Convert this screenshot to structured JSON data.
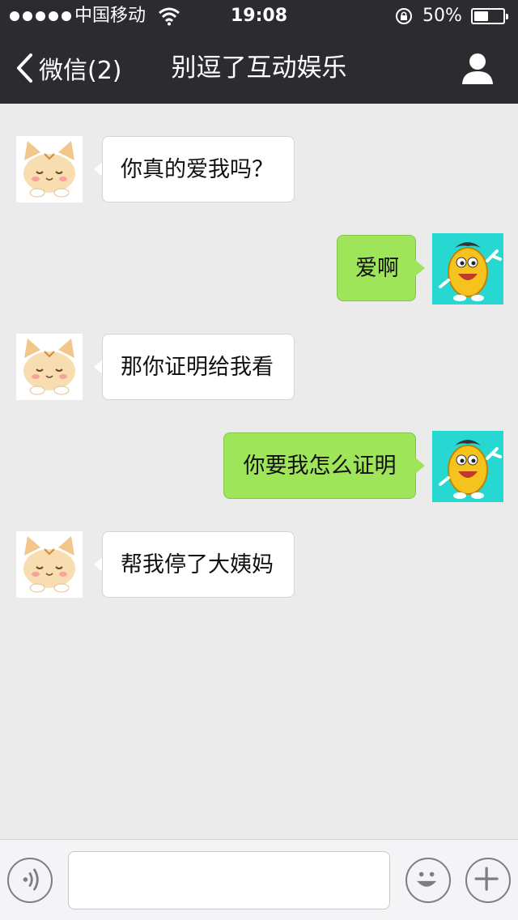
{
  "status_bar": {
    "carrier": "中国移动",
    "time": "19:08",
    "battery_percent": "50%",
    "battery_level": 0.5,
    "signal_bars": 5
  },
  "nav": {
    "back_label": "微信(2)",
    "title": "别逗了互动娱乐"
  },
  "messages": [
    {
      "sender": "other",
      "text": "你真的爱我吗？",
      "avatar": "cat-avatar"
    },
    {
      "sender": "me",
      "text": "爱啊",
      "avatar": "potato-avatar"
    },
    {
      "sender": "other",
      "text": "那你证明给我看",
      "avatar": "cat-avatar"
    },
    {
      "sender": "me",
      "text": "你要我怎么证明",
      "avatar": "potato-avatar"
    },
    {
      "sender": "other",
      "text": "帮我停了大姨妈",
      "avatar": "cat-avatar"
    }
  ],
  "input_bar": {
    "text_value": "",
    "icons": [
      "voice-icon",
      "emoji-icon",
      "plus-icon"
    ]
  },
  "colors": {
    "header_bg": "#2c2b30",
    "chat_bg": "#ebebeb",
    "outgoing_bubble": "#9fe55a",
    "incoming_bubble": "#ffffff"
  }
}
